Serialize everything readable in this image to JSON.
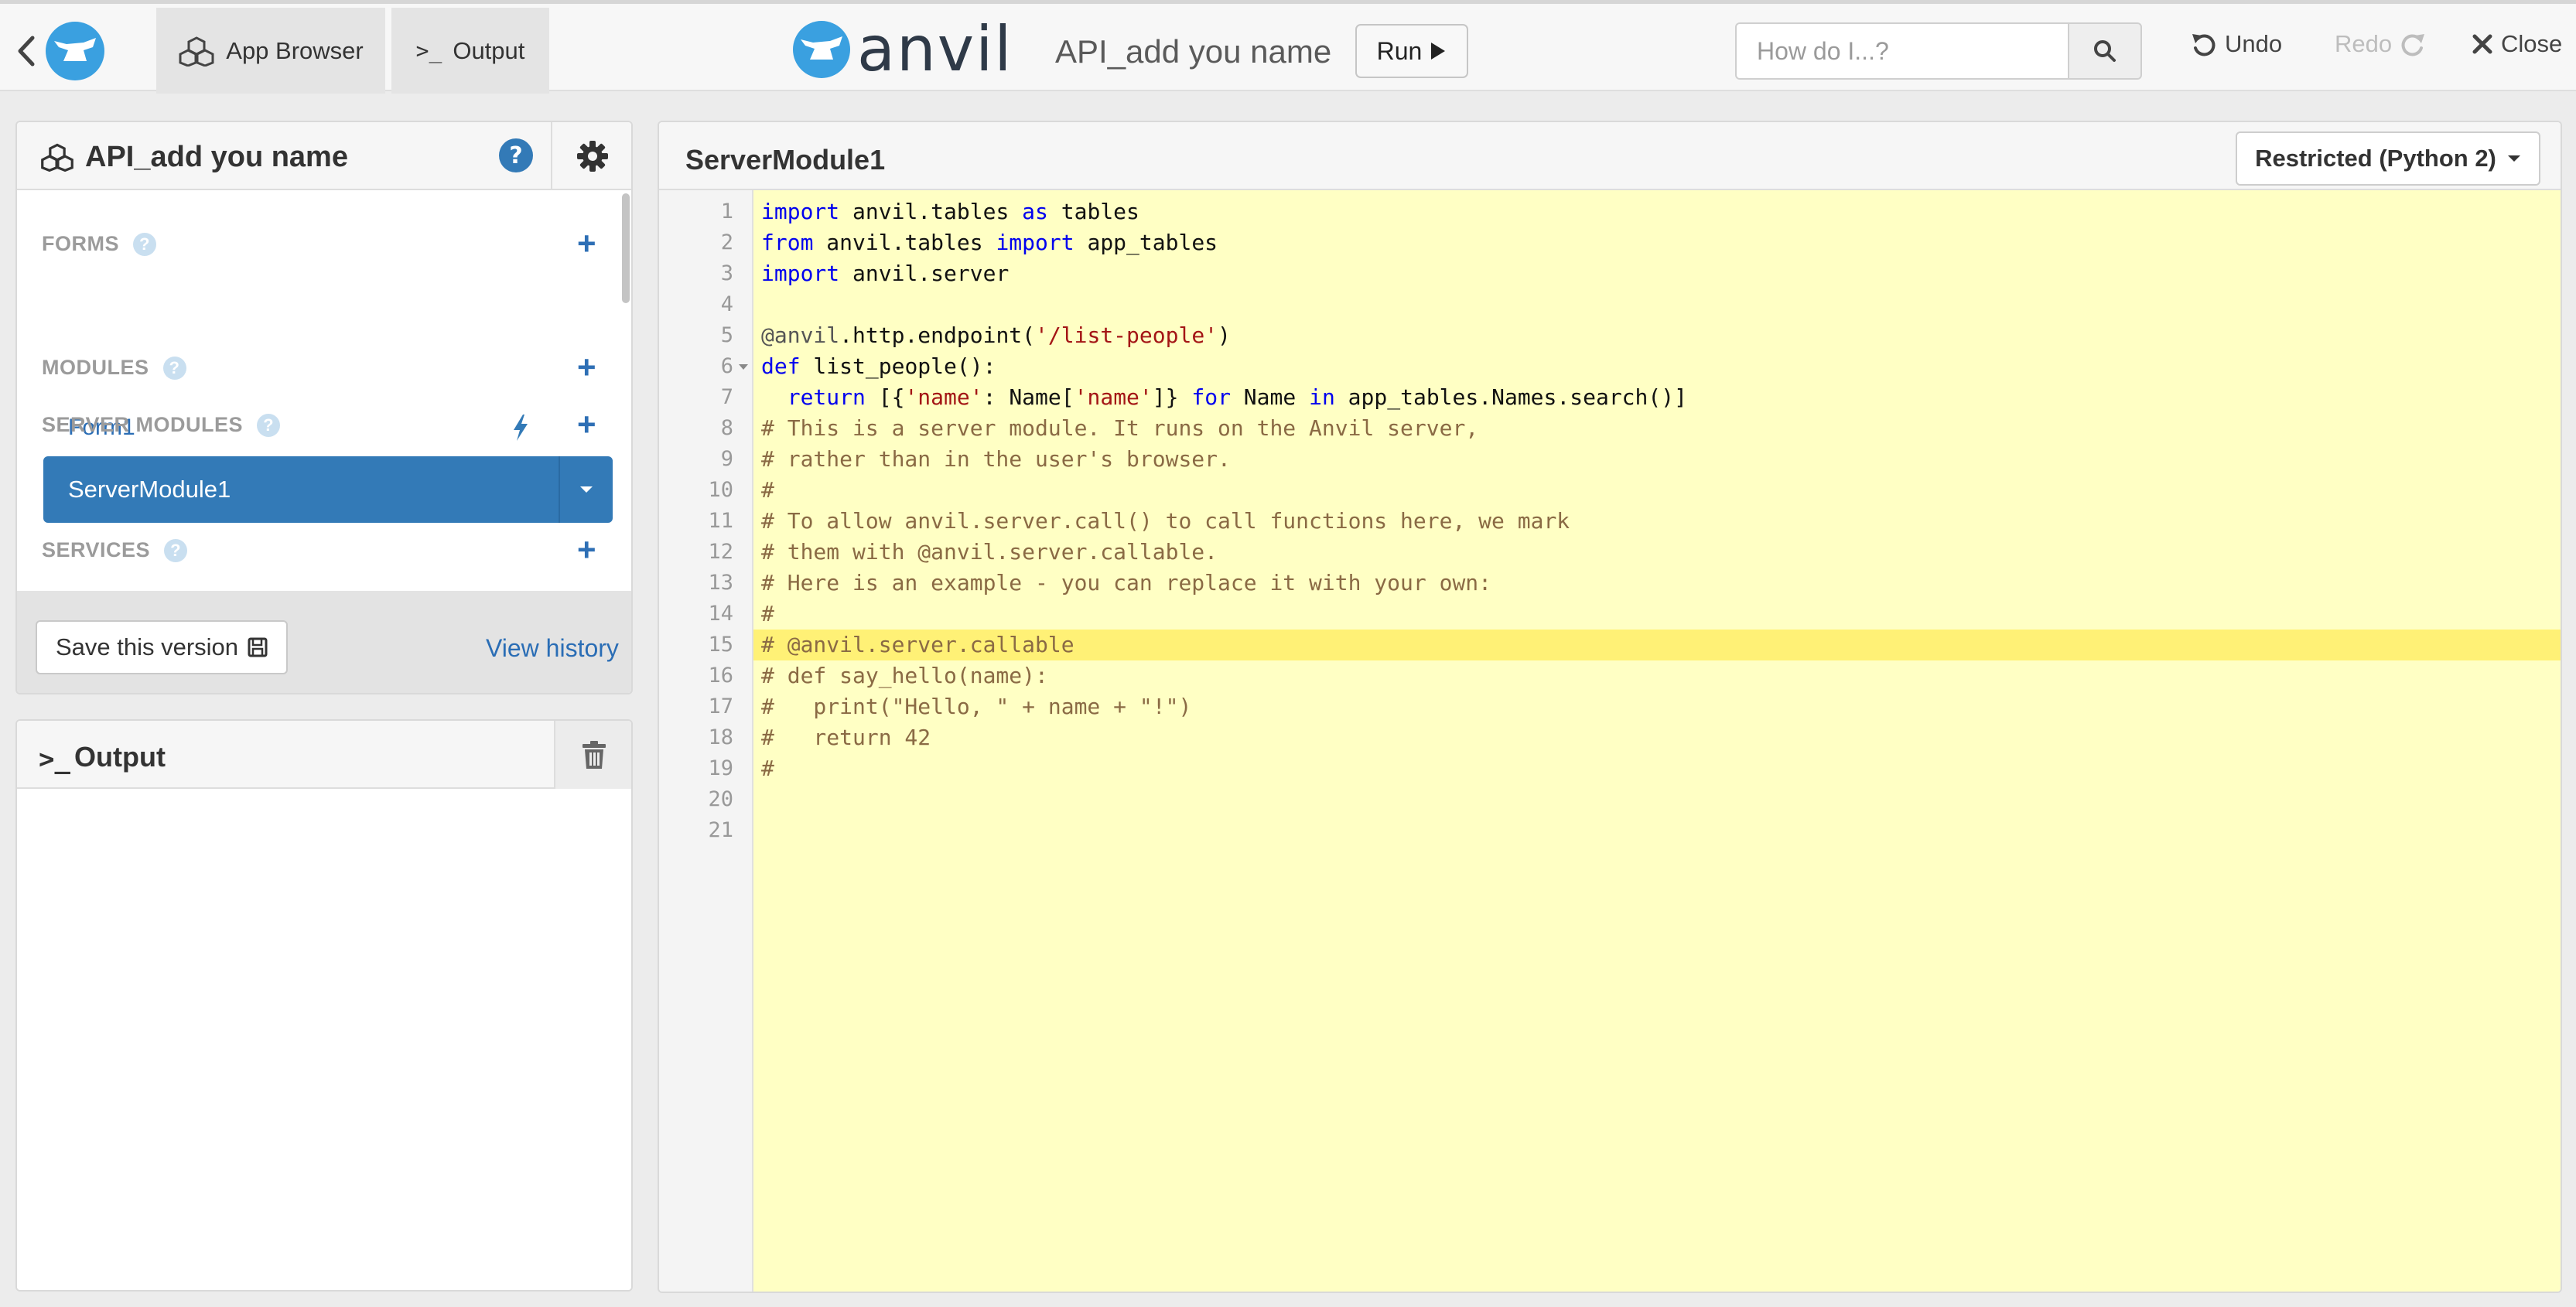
{
  "topbar": {
    "app_browser_tab": "App Browser",
    "output_tab": "Output",
    "brand": "anvil",
    "app_name": "API_add you name",
    "run_label": "Run",
    "search_placeholder": "How do I...?",
    "undo_label": "Undo",
    "redo_label": "Redo",
    "close_label": "Close"
  },
  "app_browser": {
    "title": "API_add you name",
    "sections": {
      "forms": "FORMS",
      "modules": "MODULES",
      "server_modules": "SERVER MODULES",
      "services": "SERVICES"
    },
    "form_item": "Form1",
    "server_module_item": "ServerModule1",
    "save_version_label": "Save this version",
    "view_history_label": "View history"
  },
  "output": {
    "prompt_icon": ">_",
    "title": "Output"
  },
  "editor": {
    "title": "ServerModule1",
    "python_version": "Restricted (Python 2)",
    "active_line": 15,
    "line_numbers": [
      "1",
      "2",
      "3",
      "4",
      "5",
      "6",
      "7",
      "8",
      "9",
      "10",
      "11",
      "12",
      "13",
      "14",
      "15",
      "16",
      "17",
      "18",
      "19",
      "20",
      "21"
    ],
    "code": {
      "l1_kw1": "import",
      "l1_t1": " anvil.tables ",
      "l1_kw2": "as",
      "l1_t2": " tables",
      "l2_kw1": "from",
      "l2_t1": " anvil.tables ",
      "l2_kw2": "import",
      "l2_t2": " app_tables",
      "l3_kw1": "import",
      "l3_t1": " anvil.server",
      "l5_dec": "@anvil",
      "l5_t1": ".http.endpoint(",
      "l5_str": "'/list-people'",
      "l5_t2": ")",
      "l6_kw1": "def",
      "l6_t1": " list_people():",
      "l7_ind": "  ",
      "l7_kw1": "return",
      "l7_t1": " [{",
      "l7_str1": "'name'",
      "l7_t2": ": Name[",
      "l7_str2": "'name'",
      "l7_t3": "]} ",
      "l7_kw2": "for",
      "l7_t4": " Name ",
      "l7_kw3": "in",
      "l7_t5": " app_tables.Names.search()]",
      "l8": "# This is a server module. It runs on the Anvil server,",
      "l9": "# rather than in the user's browser.",
      "l10": "#",
      "l11": "# To allow anvil.server.call() to call functions here, we mark",
      "l12": "# them with @anvil.server.callable.",
      "l13": "# Here is an example - you can replace it with your own:",
      "l14": "#",
      "l15": "# @anvil.server.callable",
      "l16": "# def say_hello(name):",
      "l17": "#   print(\"Hello, \" + name + \"!\")",
      "l18": "#   return 42",
      "l19": "#"
    }
  },
  "colors": {
    "accent": "#337ab7",
    "editor_bg": "#ffffc4",
    "active_line": "#fff176",
    "keyword": "#0000ee",
    "string": "#a31515",
    "comment": "#8a6a44"
  }
}
